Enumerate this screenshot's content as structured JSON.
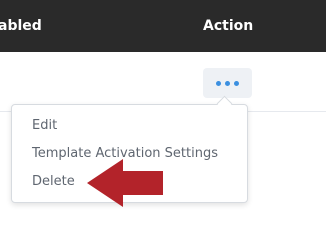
{
  "table": {
    "header": {
      "enabled_label": "abled",
      "action_label": "Action"
    }
  },
  "dropdown": {
    "items": [
      {
        "label": "Edit"
      },
      {
        "label": "Template Activation Settings"
      },
      {
        "label": "Delete"
      }
    ]
  },
  "colors": {
    "header_bg": "#2a2a2a",
    "menu_text": "#5f6670",
    "dots": "#3b8fe0",
    "arrow": "#b3232a"
  }
}
